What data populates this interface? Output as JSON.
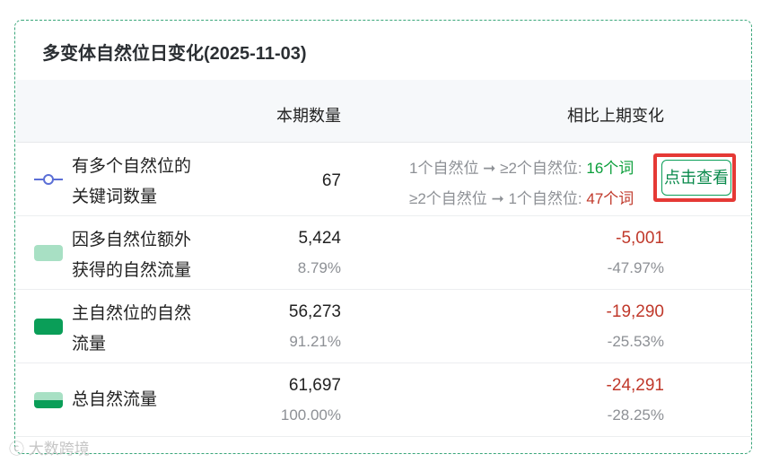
{
  "title": "多变体自然位日变化(2025-11-03)",
  "header": {
    "col_count": "本期数量",
    "col_change": "相比上期变化"
  },
  "rows": [
    {
      "label": "有多个自然位的关键词数量",
      "value": "67",
      "transitions": [
        {
          "prefix": "1个自然位 ➞ ≥2个自然位: ",
          "count": "16个词"
        },
        {
          "prefix": "≥2个自然位 ➞ 1个自然位: ",
          "count": "47个词"
        }
      ],
      "action_label": "点击查看",
      "legend_icon": "line-circle-marker-icon"
    },
    {
      "label": "因多自然位额外获得的自然流量",
      "value": "5,424",
      "percent": "8.79%",
      "change": "-5,001",
      "change_percent": "-47.97%",
      "legend_color": "#a8e0c4"
    },
    {
      "label": "主自然位的自然流量",
      "value": "56,273",
      "percent": "91.21%",
      "change": "-19,290",
      "change_percent": "-25.53%",
      "legend_color": "#0a9e58"
    },
    {
      "label": "总自然流量",
      "value": "61,697",
      "percent": "100.00%",
      "change": "-24,291",
      "change_percent": "-28.25%",
      "legend_color": "split"
    }
  ],
  "colors": {
    "accent": "#0a9e58",
    "negative": "#c0392b",
    "positive": "#0a9e3a",
    "highlight": "#e53935"
  },
  "watermark": "大数跨境"
}
